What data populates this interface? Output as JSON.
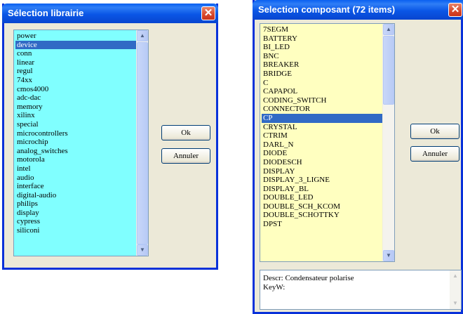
{
  "dialog_left": {
    "title": "Sélection librairie",
    "close_label": "✕",
    "items": [
      "power",
      "device",
      "conn",
      "linear",
      "regul",
      "74xx",
      "cmos4000",
      "adc-dac",
      "memory",
      "xilinx",
      "special",
      "microcontrollers",
      "microchip",
      "analog_switches",
      "motorola",
      "intel",
      "audio",
      "interface",
      "digital-audio",
      "philips",
      "display",
      "cypress",
      "siliconi"
    ],
    "selected_index": 1,
    "ok_label": "Ok",
    "cancel_label": "Annuler",
    "list_bg": "#80ffff"
  },
  "dialog_right": {
    "title": "Selection composant (72 items)",
    "close_label": "✕",
    "items": [
      "7SEGM",
      "BATTERY",
      "BI_LED",
      "BNC",
      "BREAKER",
      "BRIDGE",
      "C",
      "CAPAPOL",
      "CODING_SWITCH",
      "CONNECTOR",
      "CP",
      "CRYSTAL",
      "CTRIM",
      "DARL_N",
      "DIODE",
      "DIODESCH",
      "DISPLAY",
      "DISPLAY_3_LIGNE",
      "DISPLAY_BL",
      "DOUBLE_LED",
      "DOUBLE_SCH_KCOM",
      "DOUBLE_SCHOTTKY",
      "DPST"
    ],
    "selected_index": 10,
    "ok_label": "Ok",
    "cancel_label": "Annuler",
    "description_line1": "Descr: Condensateur polarise",
    "description_line2": "KeyW:",
    "list_bg": "#ffffc0"
  },
  "icons": {
    "close": "close-icon",
    "scroll_up": "arrow-up-icon",
    "scroll_down": "arrow-down-icon"
  },
  "colors": {
    "title_bar": "#0a56e6",
    "selection": "#316ac5",
    "dialog_bg": "#ece9d8"
  }
}
